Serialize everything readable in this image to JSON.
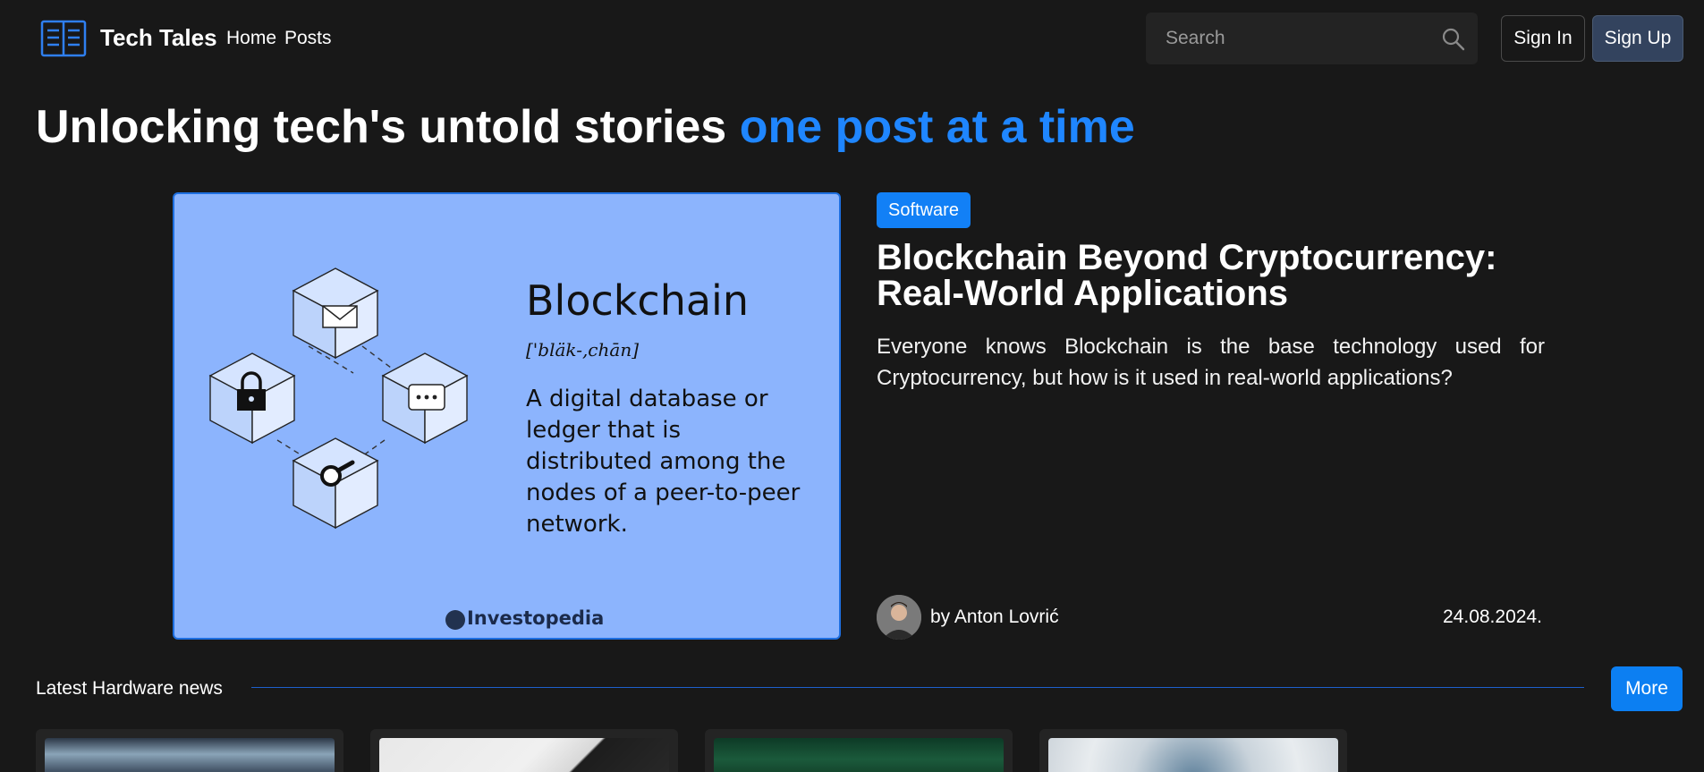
{
  "header": {
    "brand": "Tech Tales",
    "nav": [
      {
        "label": "Home"
      },
      {
        "label": "Posts"
      }
    ],
    "search_placeholder": "Search",
    "signin_label": "Sign In",
    "signup_label": "Sign Up"
  },
  "hero": {
    "headline_main": "Unlocking tech's untold stories ",
    "headline_accent": "one post at a time"
  },
  "featured": {
    "image": {
      "title": "Blockchain",
      "pronunciation": "['bläk-,chān]",
      "definition": "A digital database or ledger that is distributed among the nodes of a peer-to-peer network.",
      "source": "Investopedia"
    },
    "category": "Software",
    "title": "Blockchain Beyond Cryptocurrency: Real-World Applications",
    "excerpt": "Everyone knows Blockchain is the base technology used for Cryptocurrency, but how is it used in real-world applications?",
    "author": "by Anton Lovrić",
    "date": "24.08.2024."
  },
  "latest": {
    "title": "Latest Hardware news",
    "more_label": "More"
  },
  "colors": {
    "background": "#181818",
    "accent": "#1f86ff",
    "badge": "#1280f6",
    "signup_bg": "#33435e",
    "image_bg": "#8cb4fd"
  }
}
